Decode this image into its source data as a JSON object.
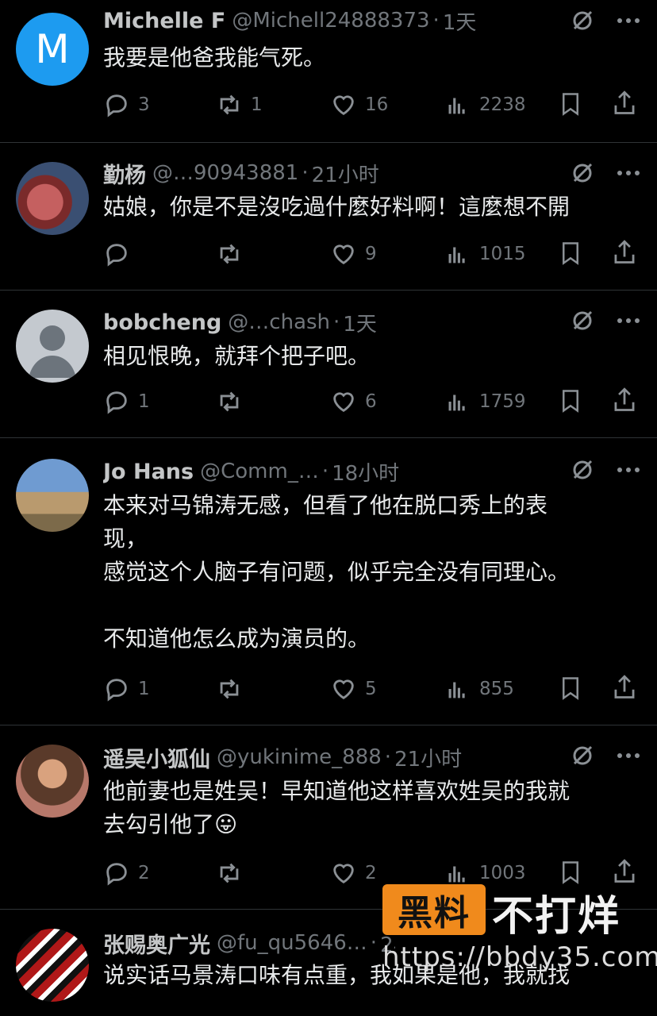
{
  "posts": [
    {
      "name": "Michelle F",
      "handle": "@Michell24888373",
      "time": "1天",
      "avatar_letter": "M",
      "text": "我要是他爸我能气死。",
      "replies": "3",
      "retweets": "1",
      "likes": "16",
      "views": "2238"
    },
    {
      "name": "勤杨",
      "handle": "@…90943881",
      "time": "21小时",
      "text": "姑娘，你是不是沒吃過什麼好料啊！這麼想不開",
      "replies": "",
      "retweets": "",
      "likes": "9",
      "views": "1015"
    },
    {
      "name": "bobcheng",
      "handle": "@…chash",
      "time": "1天",
      "text": "相见恨晚，就拜个把子吧。",
      "replies": "1",
      "retweets": "",
      "likes": "6",
      "views": "1759"
    },
    {
      "name": "Jo Hans",
      "handle": "@Comm_…",
      "time": "18小时",
      "text": "本来对马锦涛无感，但看了他在脱口秀上的表\n现，\n感觉这个人脑子有问题，似乎完全没有同理心。\n\n不知道他怎么成为演员的。",
      "replies": "1",
      "retweets": "",
      "likes": "5",
      "views": "855"
    },
    {
      "name": "遥吴小狐仙",
      "handle": "@yukinime_888",
      "time": "21小时",
      "text": "他前妻也是姓吴！早知道他这样喜欢姓吴的我就\n去勾引他了😛",
      "replies": "2",
      "retweets": "",
      "likes": "2",
      "views": "1003"
    },
    {
      "name": "张赐奥广光",
      "handle": "@fu_qu5646…",
      "time": "2小时",
      "text": "说实话马景涛口味有点重，我如果是他，我就找",
      "replies": "",
      "retweets": "",
      "likes": "",
      "views": ""
    }
  ],
  "watermark": {
    "box": "黑料",
    "tag": "不打烊",
    "url": "https://bbdy35.com"
  },
  "colors": {
    "background": "#000000",
    "text": "#e7e9ea",
    "muted": "#71767b",
    "avatar_blue": "#1d9bf0",
    "watermark_orange": "#f08a1c"
  }
}
